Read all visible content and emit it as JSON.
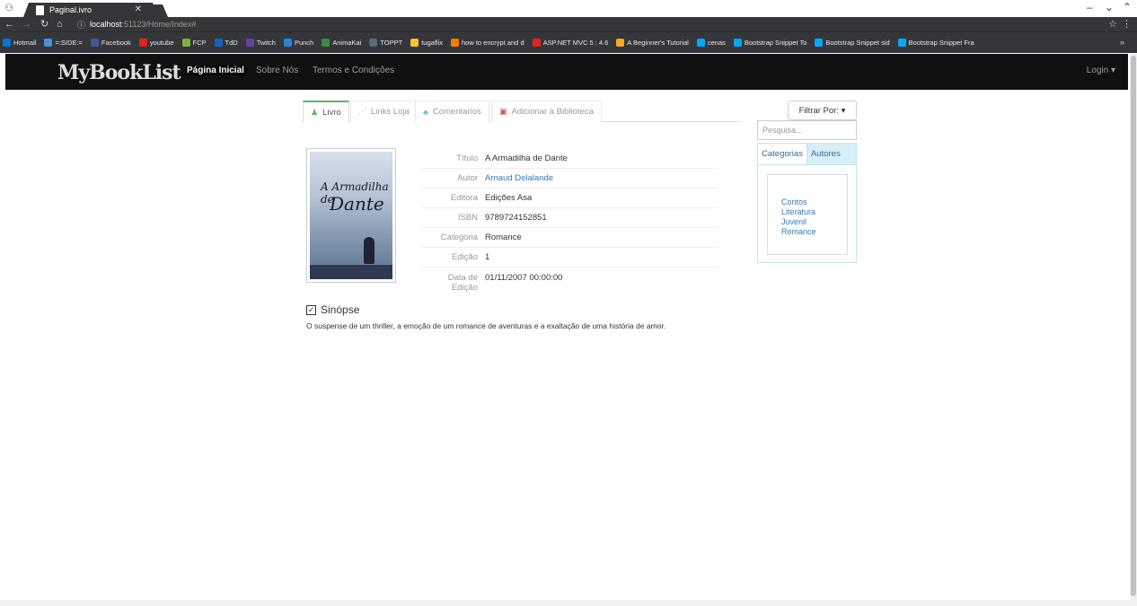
{
  "browser": {
    "tab_title": "Paginal.ivro",
    "url_host": "localhost",
    "url_path": ":51123/Home/Index#",
    "bookmarks": [
      {
        "label": "Hotmail",
        "color": "#0078d7"
      },
      {
        "label": "=:SIDE:=",
        "color": "#4a90d9"
      },
      {
        "label": "Facebook",
        "color": "#3b5998"
      },
      {
        "label": "youtube",
        "color": "#e62117"
      },
      {
        "label": "FCP",
        "color": "#7cb342"
      },
      {
        "label": "TdD",
        "color": "#1565c0"
      },
      {
        "label": "Twitch",
        "color": "#6441a5"
      },
      {
        "label": "Punch",
        "color": "#1e88e5"
      },
      {
        "label": "AnimaKai",
        "color": "#388e3c"
      },
      {
        "label": "TOPPT",
        "color": "#546e7a"
      },
      {
        "label": "tugaflix",
        "color": "#fbc02d"
      },
      {
        "label": "how to encrypt and d",
        "color": "#f57c00"
      },
      {
        "label": "ASP.NET MVC 5 : 4.6",
        "color": "#e62117"
      },
      {
        "label": "A Beginner's Tutorial",
        "color": "#f9a825"
      },
      {
        "label": "cenas",
        "color": "#03a9f4"
      },
      {
        "label": "Bootstrap Snippet To",
        "color": "#03a9f4"
      },
      {
        "label": "Bootstrap Snippet sid",
        "color": "#03a9f4"
      },
      {
        "label": "Bootstrap Snippet Fra",
        "color": "#03a9f4"
      }
    ]
  },
  "nav": {
    "brand": "MyBookList",
    "links": [
      "Página Inicial",
      "Sobre Nós",
      "Termos e Condições"
    ],
    "login": "Login ▾"
  },
  "tabs": [
    {
      "label": "Livro",
      "icon": "user-icon"
    },
    {
      "label": "Links Loja",
      "icon": "rss-icon"
    },
    {
      "label": "Comentarios",
      "icon": "users-icon"
    },
    {
      "label": "Adicionar à Biblioteca",
      "icon": "image-icon"
    }
  ],
  "book": {
    "cover_title_1": "A Armadilha de",
    "cover_title_2": "Dante",
    "fields": [
      {
        "key": "Título",
        "value": "A Armadilha de Dante"
      },
      {
        "key": "Autor",
        "value": "Arnaud Delalande"
      },
      {
        "key": "Editora",
        "value": "Edições Asa"
      },
      {
        "key": "ISBN",
        "value": "9789724152851"
      },
      {
        "key": "Categoria",
        "value": "Romance"
      },
      {
        "key": "Edição",
        "value": "1"
      },
      {
        "key": "Data de Edição",
        "value": "01/11/2007 00:00:00"
      }
    ],
    "synopsis_title": "Sinópse",
    "synopsis": "O suspense de um thriller, a emoção de um romance de aventuras e a exaltação de uma história de amor."
  },
  "sidebar": {
    "filter_label": "Filtrar Por: ▾",
    "search_placeholder": "Pesquisa...",
    "panel_tabs": [
      "Categorias",
      "Autores"
    ],
    "categories": [
      "Contos",
      "Literatura",
      "Juvenil",
      "Romance"
    ]
  }
}
